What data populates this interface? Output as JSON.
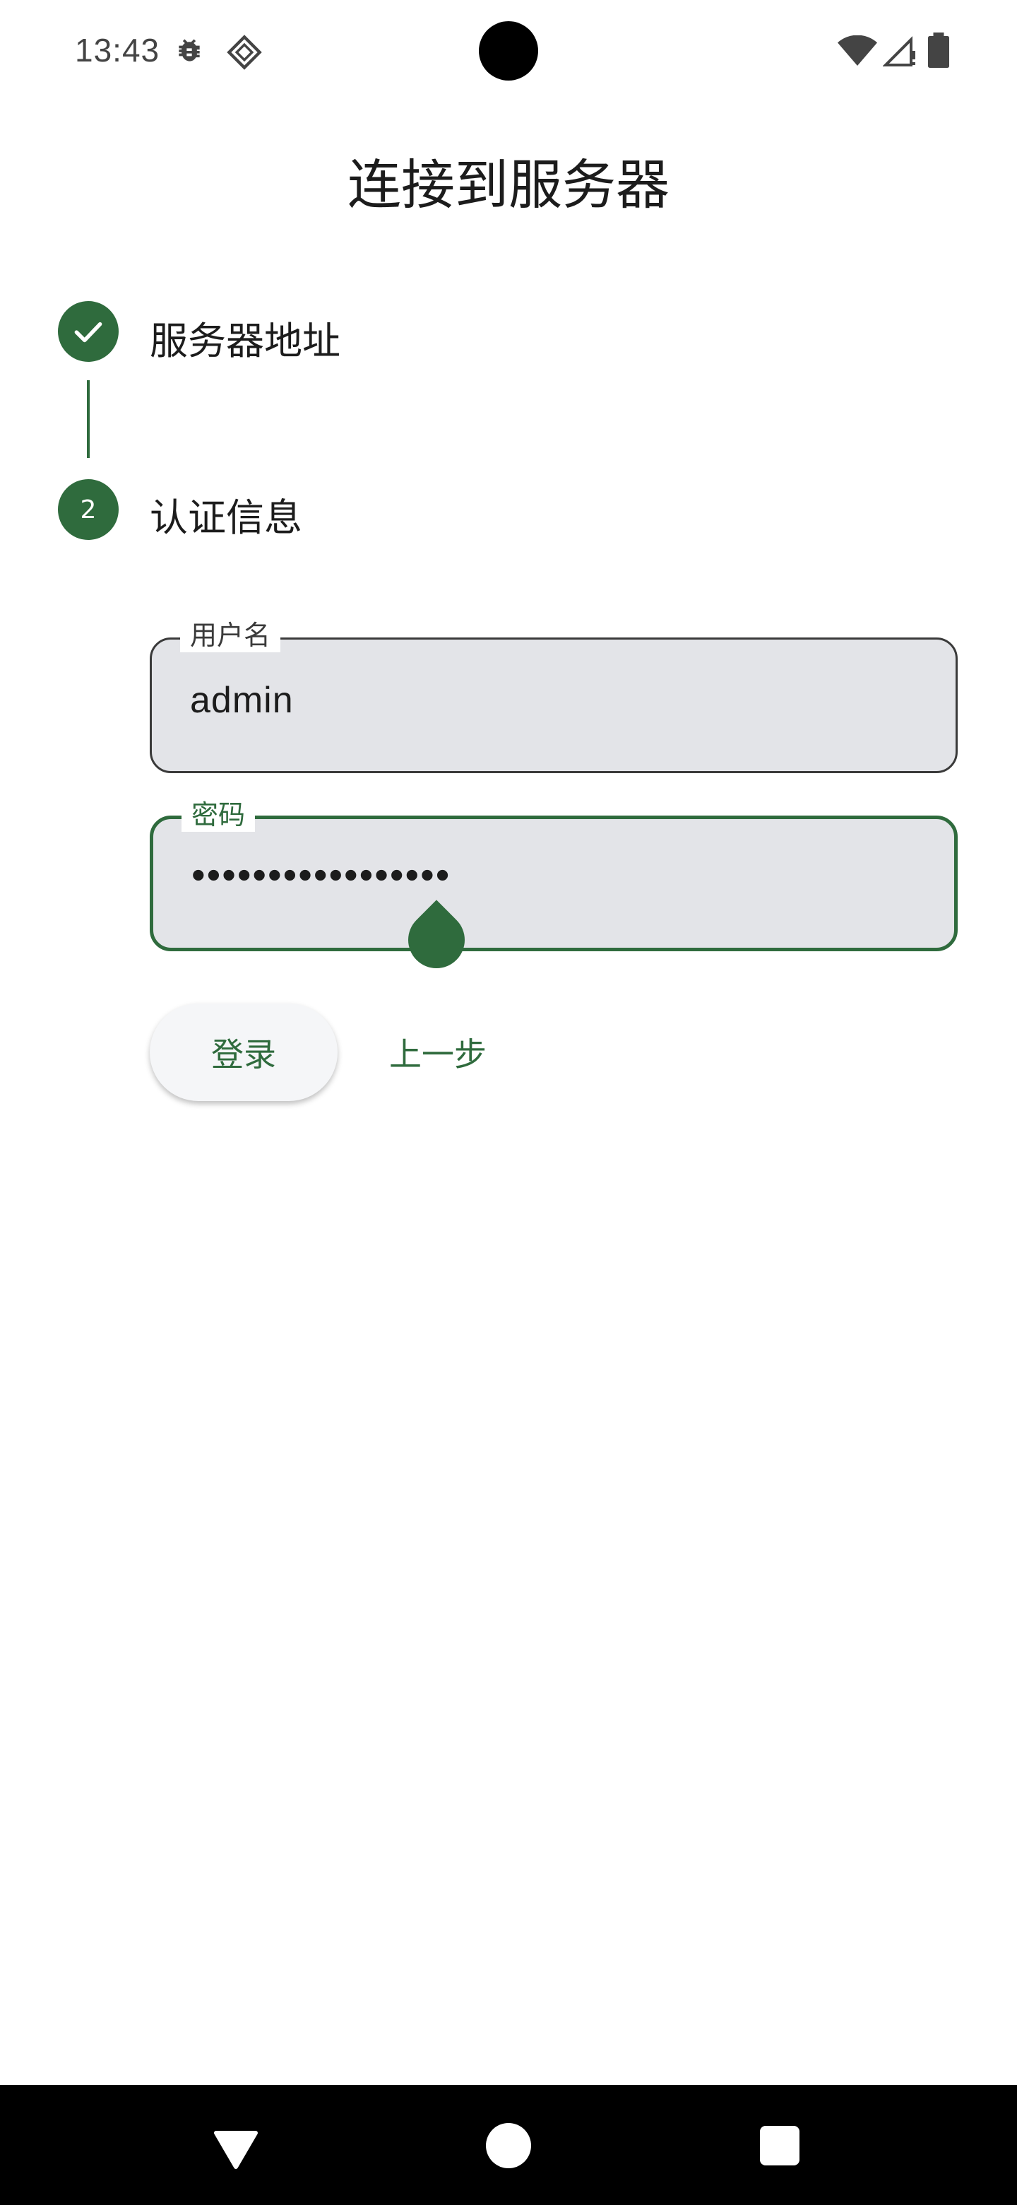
{
  "status_bar": {
    "time": "13:43",
    "icons": [
      "bug-icon",
      "diamond-icon",
      "wifi-icon",
      "signal-icon",
      "battery-icon"
    ]
  },
  "page": {
    "title": "连接到服务器"
  },
  "stepper": {
    "steps": [
      {
        "label": "服务器地址",
        "state": "completed",
        "icon": "check-icon"
      },
      {
        "label": "认证信息",
        "state": "active",
        "number": "2"
      }
    ]
  },
  "form": {
    "username": {
      "label": "用户名",
      "value": "admin"
    },
    "password": {
      "label": "密码",
      "value": "•••••••••••••••••"
    }
  },
  "actions": {
    "login_label": "登录",
    "back_label": "上一步"
  },
  "nav_bar": {
    "icons": [
      "nav-back-icon",
      "nav-home-icon",
      "nav-recents-icon"
    ]
  },
  "colors": {
    "accent": "#2f6b3d",
    "field_background": "#e3e4e8",
    "text": "#1c1c1c"
  }
}
